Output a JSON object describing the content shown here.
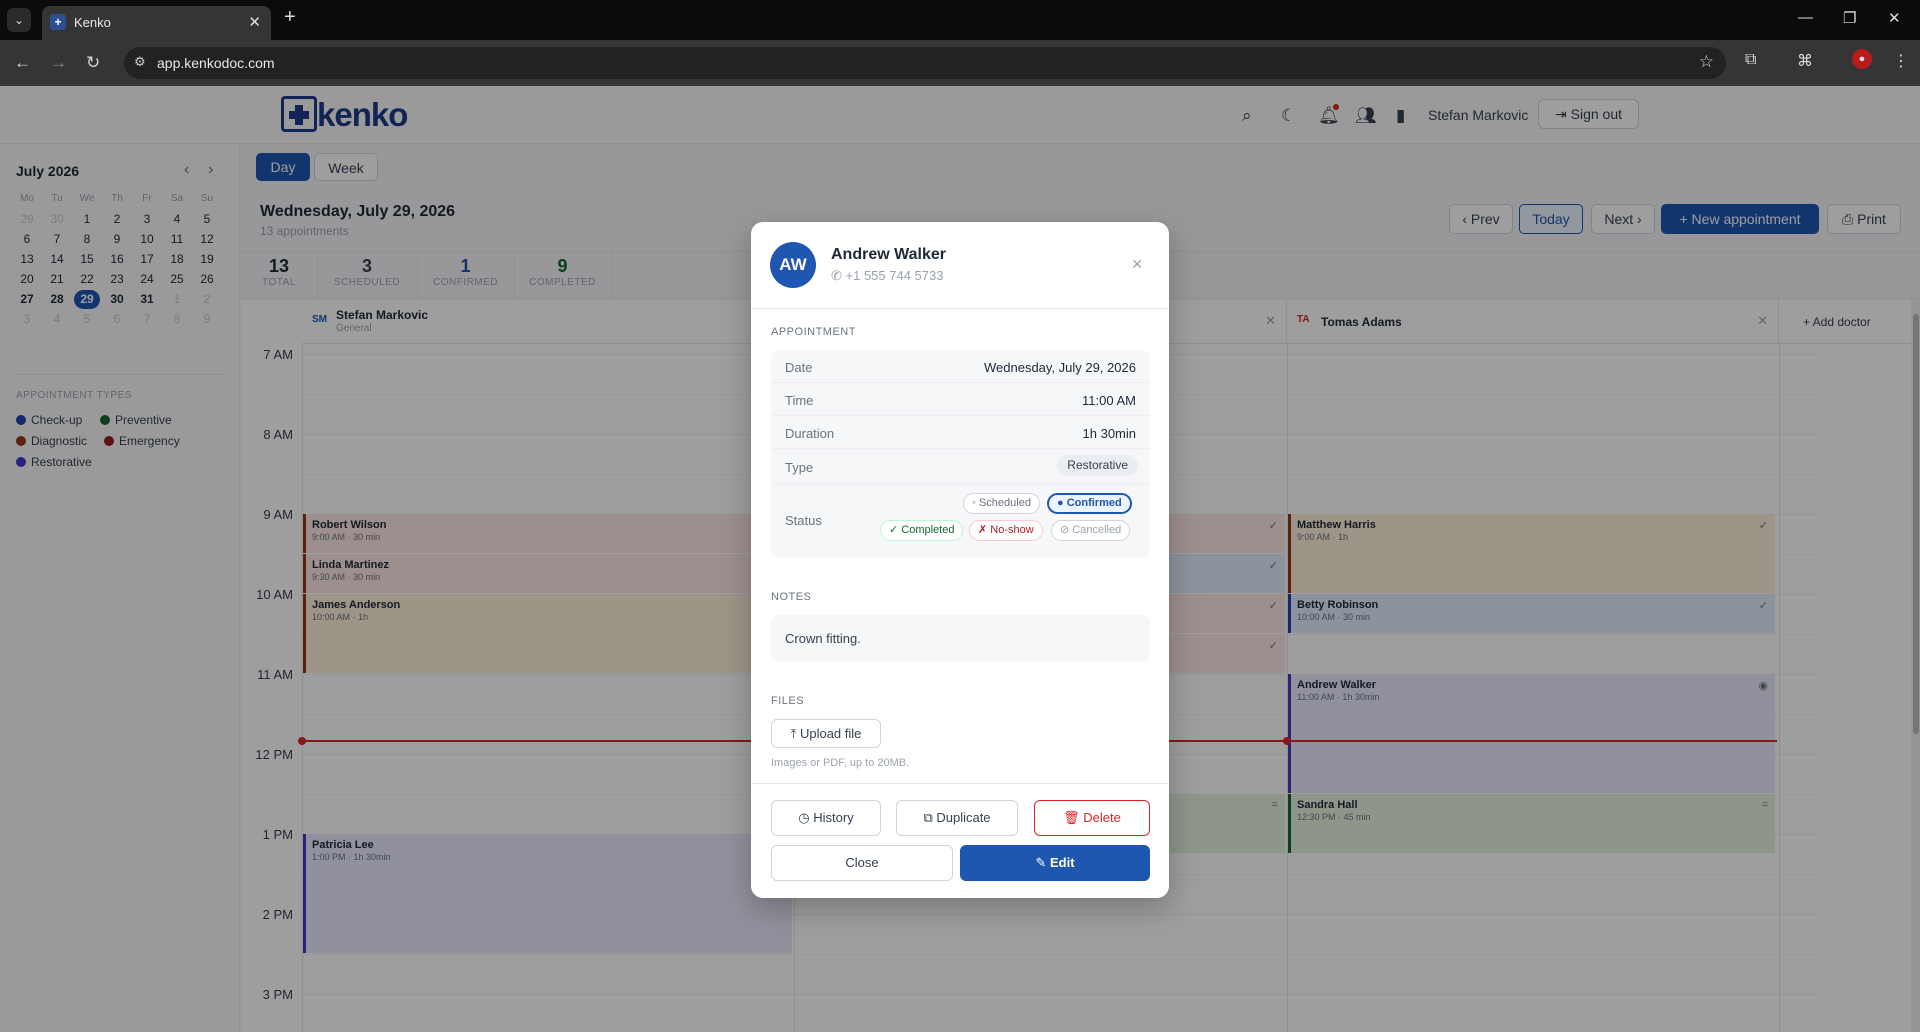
{
  "browser": {
    "tab_title": "Kenko",
    "url": "app.kenkodoc.com"
  },
  "header": {
    "logo_text": "kenko",
    "user_name": "Stefan Markovic",
    "sign_out": "Sign out"
  },
  "mini_calendar": {
    "title": "July 2026",
    "weekdays": [
      "Mo",
      "Tu",
      "We",
      "Th",
      "Fr",
      "Sa",
      "Su"
    ],
    "weeks": [
      [
        "29",
        "30",
        "1",
        "2",
        "3",
        "4",
        "5"
      ],
      [
        "6",
        "7",
        "8",
        "9",
        "10",
        "11",
        "12"
      ],
      [
        "13",
        "14",
        "15",
        "16",
        "17",
        "18",
        "19"
      ],
      [
        "20",
        "21",
        "22",
        "23",
        "24",
        "25",
        "26"
      ],
      [
        "27",
        "28",
        "29",
        "30",
        "31",
        "1",
        "2"
      ],
      [
        "3",
        "4",
        "5",
        "6",
        "7",
        "8",
        "9"
      ]
    ],
    "selected": "29"
  },
  "appointment_types": {
    "title": "APPOINTMENT TYPES",
    "items": [
      {
        "label": "Check-up",
        "color": "#1e40af"
      },
      {
        "label": "Preventive",
        "color": "#166534"
      },
      {
        "label": "Diagnostic",
        "color": "#9a3412"
      },
      {
        "label": "Emergency",
        "color": "#991b1b"
      },
      {
        "label": "Restorative",
        "color": "#4338ca"
      }
    ]
  },
  "toolbar": {
    "day": "Day",
    "week": "Week",
    "date_title": "Wednesday, July 29, 2026",
    "date_sub": "13 appointments",
    "prev": "‹ Prev",
    "today": "Today",
    "next": "Next ›",
    "new_appt": "+  New appointment",
    "print": "Print"
  },
  "stats": [
    {
      "n": "13",
      "l": "TOTAL",
      "color": "#1f2937"
    },
    {
      "n": "3",
      "l": "SCHEDULED",
      "color": "#374151"
    },
    {
      "n": "1",
      "l": "CONFIRMED",
      "color": "#1e56b0"
    },
    {
      "n": "9",
      "l": "COMPLETED",
      "color": "#166534"
    }
  ],
  "doctors": [
    {
      "initials": "SM",
      "name": "Stefan Markovic",
      "specialty": "General"
    },
    {
      "initials": "",
      "name": "",
      "specialty": ""
    },
    {
      "initials": "TA",
      "name": "Tomas Adams",
      "specialty": ""
    }
  ],
  "add_doctor": "+  Add doctor",
  "hours": [
    "7 AM",
    "8 AM",
    "9 AM",
    "10 AM",
    "11 AM",
    "12 PM",
    "1 PM",
    "2 PM",
    "3 PM"
  ],
  "appointments_col1": [
    {
      "name": "Robert Wilson",
      "time": "9:00 AM · 30 min"
    },
    {
      "name": "Linda Martinez",
      "time": "9:30 AM · 30 min"
    },
    {
      "name": "James Anderson",
      "time": "10:00 AM · 1h"
    },
    {
      "name": "Patricia Lee",
      "time": "1:00 PM · 1h 30min"
    }
  ],
  "appointments_col3": [
    {
      "name": "Matthew Harris",
      "time": "9:00 AM · 1h"
    },
    {
      "name": "Betty Robinson",
      "time": "10:00 AM · 30 min"
    },
    {
      "name": "Andrew Walker",
      "time": "11:00 AM · 1h 30min"
    },
    {
      "name": "Sandra Hall",
      "time": "12:30 PM · 45 min"
    }
  ],
  "modal": {
    "initials": "AW",
    "patient": "Andrew Walker",
    "phone": "+1 555 744 5733",
    "appointment_heading": "APPOINTMENT",
    "date_label": "Date",
    "date_value": "Wednesday, July 29, 2026",
    "time_label": "Time",
    "time_value": "11:00 AM",
    "duration_label": "Duration",
    "duration_value": "1h 30min",
    "type_label": "Type",
    "type_value": "Restorative",
    "status_label": "Status",
    "status_options": {
      "scheduled": "◦ Scheduled",
      "confirmed": "● Confirmed",
      "completed": "✓ Completed",
      "noshow": "✗ No-show",
      "cancelled": "⊘ Cancelled"
    },
    "notes_heading": "NOTES",
    "notes": "Crown fitting.",
    "files_heading": "FILES",
    "upload": "Upload file",
    "hint": "Images or PDF, up to 20MB.",
    "history": "History",
    "duplicate": "Duplicate",
    "delete": "Delete",
    "close": "Close",
    "edit": "Edit"
  }
}
